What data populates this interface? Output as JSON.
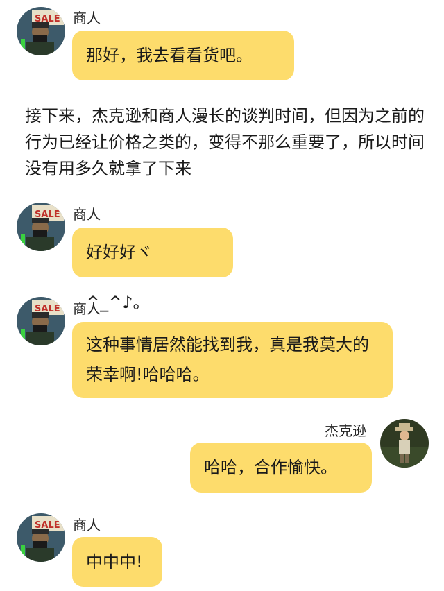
{
  "theme": {
    "bubble_color": "#fddc6c",
    "background": "#ffffff"
  },
  "messages": [
    {
      "sender": "商人",
      "side": "left",
      "avatar": "merchant-avatar-icon",
      "text": "那好，我去看看货吧。"
    },
    {
      "sender": "商人",
      "side": "left",
      "avatar": "merchant-avatar-icon",
      "text": "好好好ヾ ^_^♪。"
    },
    {
      "sender": "商人",
      "side": "left",
      "avatar": "merchant-avatar-icon",
      "text": "这种事情居然能找到我，真是我莫大的荣幸啊!哈哈哈。"
    },
    {
      "sender": "杰克逊",
      "side": "right",
      "avatar": "jackson-avatar-icon",
      "text": "哈哈，合作愉快。"
    },
    {
      "sender": "商人",
      "side": "left",
      "avatar": "merchant-avatar-icon",
      "text": "中中中!"
    }
  ],
  "narration": "接下来，杰克逊和商人漫长的谈判时间，但因为之前的行为已经让价格之类的，变得不那么重要了，所以时间没有用多久就拿了下来"
}
